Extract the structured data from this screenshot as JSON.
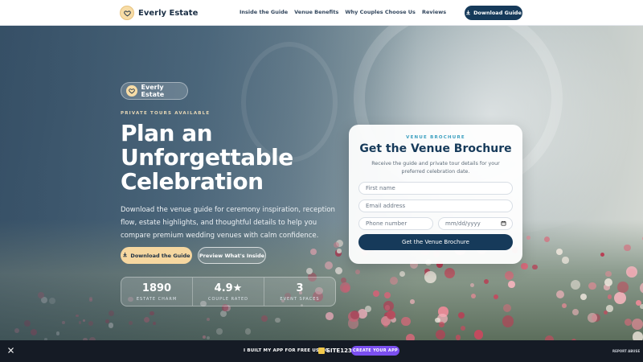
{
  "header": {
    "brand_name": "Everly Estate",
    "nav": [
      "Inside the Guide",
      "Venue Benefits",
      "Why Couples Choose Us",
      "Reviews"
    ],
    "cta_label": "Download Guide"
  },
  "hero": {
    "pill_name": "Everly Estate",
    "eyebrow": "PRIVATE TOURS AVAILABLE",
    "headline": "Plan an Unforgettable Celebration",
    "subcopy": "Download the venue guide for ceremony inspiration, reception flow, estate highlights, and thoughtful details to help you compare premium wedding venues with calm confidence.",
    "primary_button": "Download the Guide",
    "secondary_button": "Preview What's Inside",
    "stats": [
      {
        "value": "1890",
        "label": "ESTATE CHARM"
      },
      {
        "value": "4.9★",
        "label": "COUPLE RATED"
      },
      {
        "value": "3",
        "label": "EVENT SPACES"
      }
    ]
  },
  "form": {
    "eyebrow": "VENUE BROCHURE",
    "title": "Get the Venue Brochure",
    "description": "Receive the guide and private tour details for your preferred celebration date.",
    "first_name_placeholder": "First name",
    "email_placeholder": "Email address",
    "phone_placeholder": "Phone number",
    "date_placeholder": "mm/dd/yyyy",
    "submit_label": "Get the Venue Brochure"
  },
  "banner": {
    "text": "I BUILT MY APP FOR FREE USING",
    "logo_text": "SITE123",
    "cta_label": "CREATE YOUR APP",
    "report_label": "REPORT ABUSE"
  },
  "colors": {
    "navy": "#163a5a",
    "gold": "#f6d7a0",
    "accent_teal": "#3a9fbf",
    "banner_purple": "#7b4ff0"
  },
  "icons": [
    "heart-icon",
    "download-icon",
    "calendar-icon",
    "close-icon"
  ]
}
